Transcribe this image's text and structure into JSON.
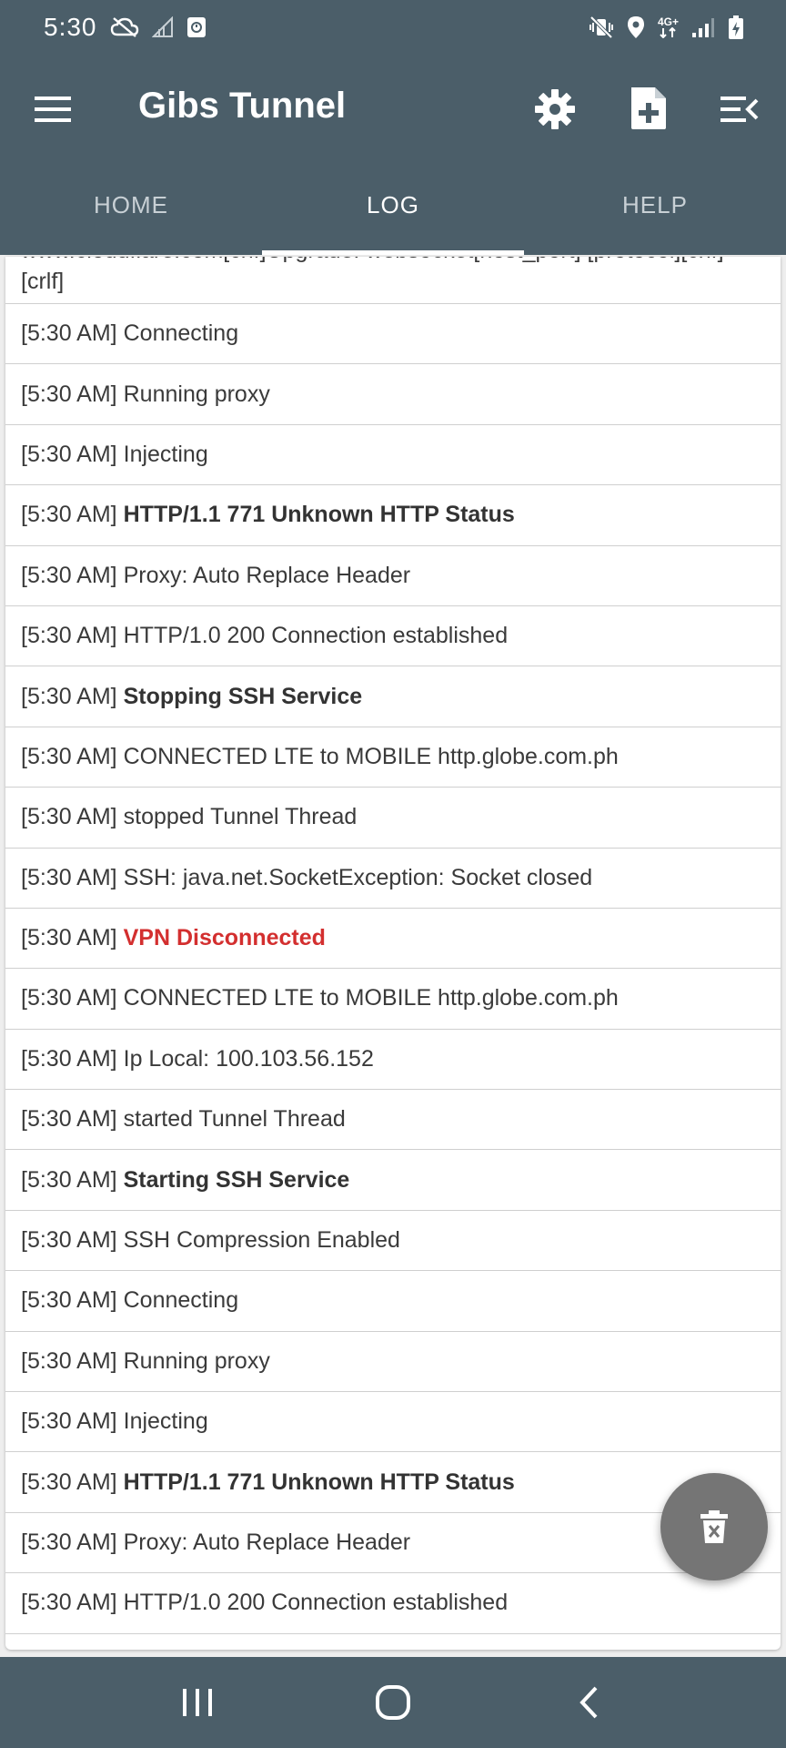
{
  "status_bar": {
    "time": "5:30",
    "network_label_top": "4G+",
    "icons": [
      "cloud-off-icon",
      "no-signal-icon",
      "notification-icon",
      "mute-vibrate-icon",
      "location-icon",
      "network-4g-icon",
      "signal-icon",
      "battery-charging-icon"
    ]
  },
  "app_bar": {
    "title": "Gibs Tunnel",
    "icons": [
      "menu-icon",
      "settings-icon",
      "add-file-icon",
      "menu-open-icon"
    ]
  },
  "tabs": [
    {
      "label": "HOME",
      "active": false
    },
    {
      "label": "LOG",
      "active": true
    },
    {
      "label": "HELP",
      "active": false
    }
  ],
  "log": {
    "first_entry_text": "www.cloudflare.com[crlf]Upgrade: websocket[host_port] [protocol][crlf][crlf]",
    "entries": [
      {
        "time": "[5:30 AM]",
        "message": "Connecting",
        "style": "normal"
      },
      {
        "time": "[5:30 AM]",
        "message": "Running proxy",
        "style": "normal"
      },
      {
        "time": "[5:30 AM]",
        "message": "Injecting",
        "style": "normal"
      },
      {
        "time": "[5:30 AM]",
        "message": "HTTP/1.1 771 Unknown HTTP Status",
        "style": "bold"
      },
      {
        "time": "[5:30 AM]",
        "message": "Proxy: Auto Replace Header",
        "style": "normal"
      },
      {
        "time": "[5:30 AM]",
        "message": "HTTP/1.0 200 Connection established",
        "style": "normal"
      },
      {
        "time": "[5:30 AM]",
        "message": "Stopping SSH Service",
        "style": "bold"
      },
      {
        "time": "[5:30 AM]",
        "message": "CONNECTED LTE to MOBILE http.globe.com.ph",
        "style": "normal"
      },
      {
        "time": "[5:30 AM]",
        "message": "stopped Tunnel Thread",
        "style": "normal"
      },
      {
        "time": "[5:30 AM]",
        "message": "SSH: java.net.SocketException: Socket closed",
        "style": "normal"
      },
      {
        "time": "[5:30 AM]",
        "message": "VPN Disconnected",
        "style": "red"
      },
      {
        "time": "[5:30 AM]",
        "message": "CONNECTED LTE to MOBILE http.globe.com.ph",
        "style": "normal"
      },
      {
        "time": "[5:30 AM]",
        "message": "Ip Local: 100.103.56.152",
        "style": "normal"
      },
      {
        "time": "[5:30 AM]",
        "message": "started Tunnel Thread",
        "style": "normal"
      },
      {
        "time": "[5:30 AM]",
        "message": "Starting SSH Service",
        "style": "bold"
      },
      {
        "time": "[5:30 AM]",
        "message": "SSH Compression Enabled",
        "style": "normal"
      },
      {
        "time": "[5:30 AM]",
        "message": "Connecting",
        "style": "normal"
      },
      {
        "time": "[5:30 AM]",
        "message": "Running proxy",
        "style": "normal"
      },
      {
        "time": "[5:30 AM]",
        "message": "Injecting",
        "style": "normal"
      },
      {
        "time": "[5:30 AM]",
        "message": "HTTP/1.1 771 Unknown HTTP Status",
        "style": "bold"
      },
      {
        "time": "[5:30 AM]",
        "message": "Proxy: Auto Replace Header",
        "style": "normal"
      },
      {
        "time": "[5:30 AM]",
        "message": "HTTP/1.0 200 Connection established",
        "style": "normal"
      }
    ]
  },
  "fab": {
    "icon": "delete-icon"
  },
  "nav_bar": {
    "icons": [
      "recent-apps-icon",
      "home-icon",
      "back-icon"
    ]
  },
  "colors": {
    "primary": "#4b5e69",
    "error_text": "#d32f2f",
    "fab": "#757575"
  }
}
